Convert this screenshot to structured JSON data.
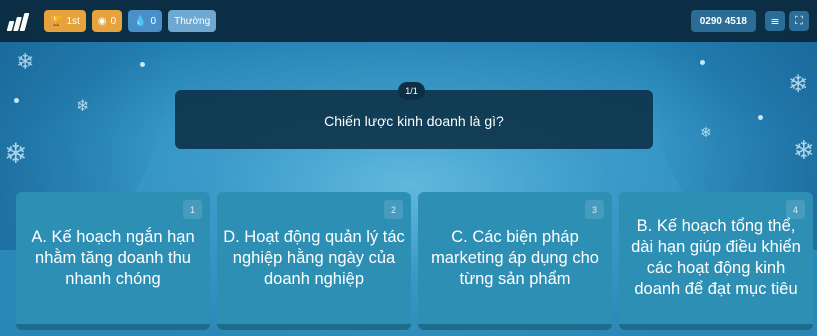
{
  "topbar": {
    "rank": "1st",
    "coins": "0",
    "drops": "0",
    "mode": "Thường",
    "game_code": "0290 4518",
    "icons": [
      "logo-icon",
      "trophy-icon",
      "coin-icon",
      "drop-icon",
      "menu-icon",
      "fullscreen-icon"
    ]
  },
  "question": {
    "counter": "1/1",
    "text": "Chiến lược kinh doanh là gì?"
  },
  "answers": [
    {
      "number": "1",
      "text": "A. Kế hoạch ngắn hạn nhằm tăng doanh thu nhanh chóng"
    },
    {
      "number": "2",
      "text": "D. Hoạt động quản lý tác nghiệp hằng ngày của doanh nghiệp"
    },
    {
      "number": "3",
      "text": "C. Các biện pháp marketing áp dụng cho từng sản phẩm"
    },
    {
      "number": "4",
      "text": "B. Kế hoạch tổng thể, dài hạn giúp điều khiển các hoạt động kinh doanh để đạt mục tiêu"
    }
  ],
  "colors": {
    "topbar_bg": "#0a283c",
    "answer_bg": "#2e8fb4",
    "accent_orange": "#e6a23c"
  }
}
